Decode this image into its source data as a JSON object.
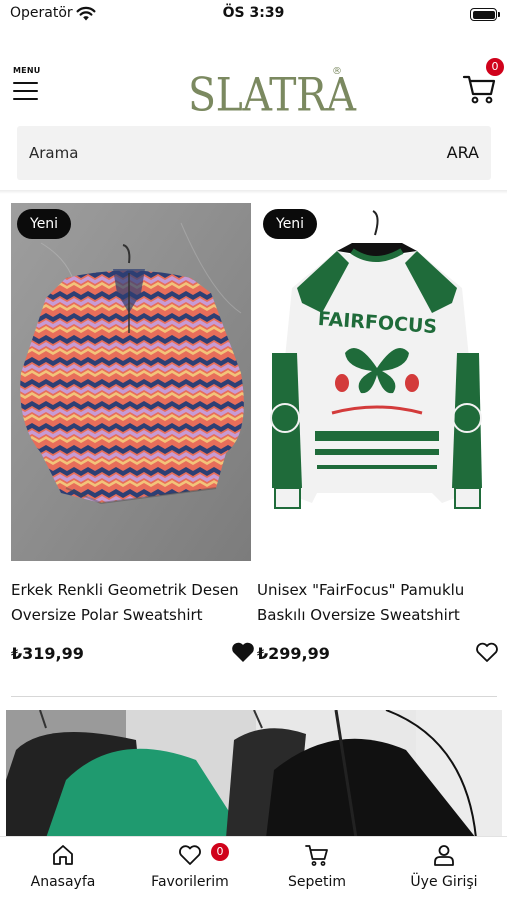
{
  "status_bar": {
    "carrier": "Operatör",
    "time": "ÖS 3:39",
    "wifi_icon": "wifi-icon",
    "battery_icon": "battery-icon"
  },
  "header": {
    "menu_label": "MENU",
    "logo": "SLATRA",
    "logo_mark": "®",
    "cart_count": "0"
  },
  "search": {
    "placeholder": "Arama",
    "button_label": "ARA"
  },
  "products": [
    {
      "badge": "Yeni",
      "name": "Erkek Renkli Geometrik Desen Oversize Polar Sweatshirt",
      "price": "₺319,99",
      "favorited": true
    },
    {
      "badge": "Yeni",
      "name": "Unisex \"FairFocus\" Pamuklu Baskılı Oversize Sweatshirt",
      "price": "₺299,99",
      "favorited": false
    }
  ],
  "product_art": {
    "print_text": "FAIRFOCUS"
  },
  "tabbar": {
    "tabs": [
      {
        "label": "Anasayfa",
        "icon": "home-icon"
      },
      {
        "label": "Favorilerim",
        "icon": "heart-icon"
      },
      {
        "label": "Sepetim",
        "icon": "cart-icon"
      },
      {
        "label": "Üye Girişi",
        "icon": "user-icon"
      }
    ],
    "favorites_count": "0"
  },
  "colors": {
    "logo": "#7b8960",
    "badge_red": "#d0021b",
    "new_badge": "#0b0b0b",
    "search_bg": "#f2f2f2"
  }
}
